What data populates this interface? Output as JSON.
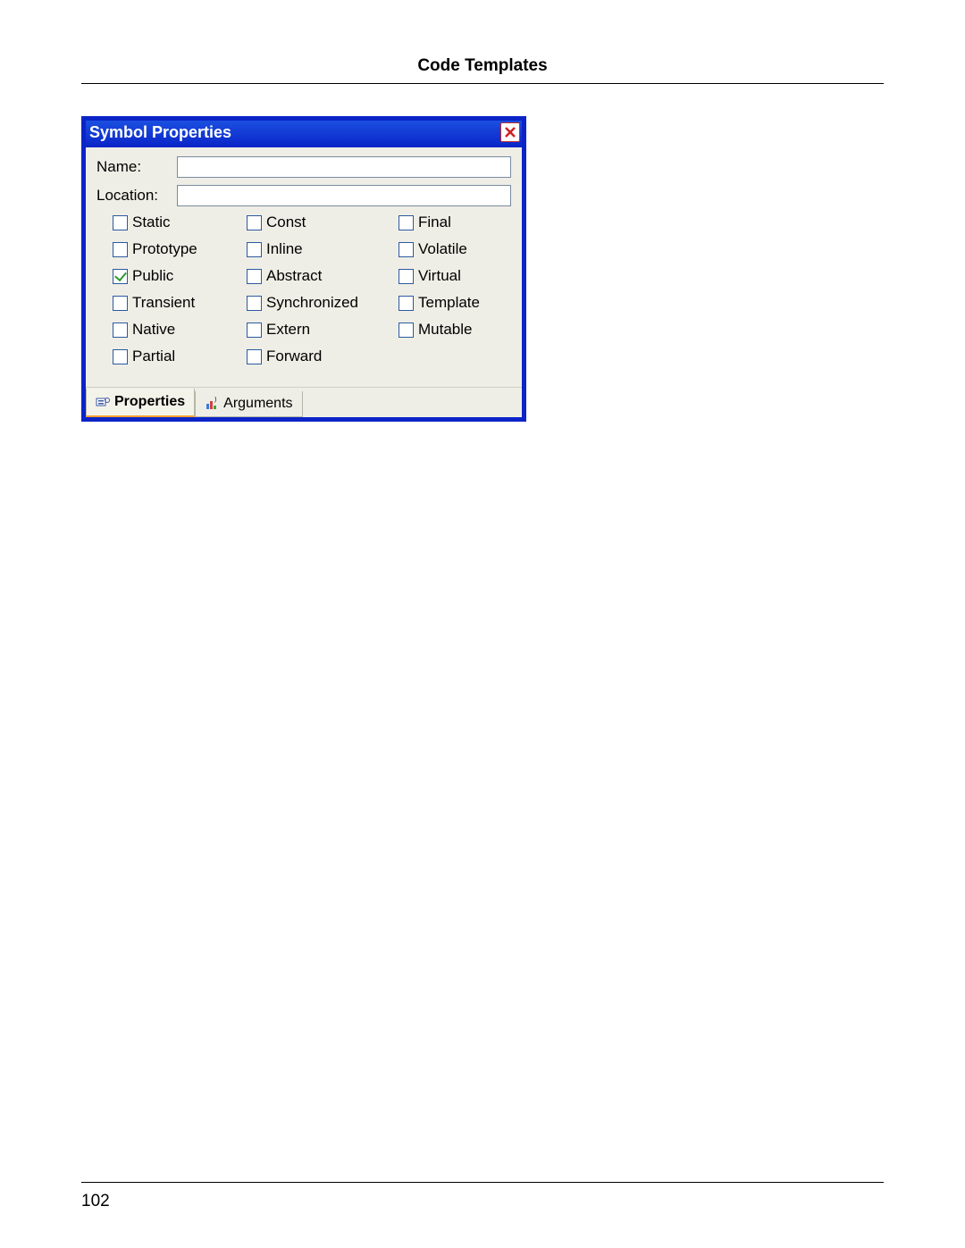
{
  "page": {
    "header": "Code Templates",
    "number": "102"
  },
  "dialog": {
    "title": "Symbol Properties",
    "fields": {
      "name": {
        "label": "Name:",
        "value": ""
      },
      "location": {
        "label": "Location:",
        "value": ""
      }
    },
    "checkboxes": {
      "col1": [
        {
          "label": "Static",
          "checked": false
        },
        {
          "label": "Prototype",
          "checked": false
        },
        {
          "label": "Public",
          "checked": true
        },
        {
          "label": "Transient",
          "checked": false
        },
        {
          "label": "Native",
          "checked": false
        },
        {
          "label": "Partial",
          "checked": false
        }
      ],
      "col2": [
        {
          "label": "Const",
          "checked": false
        },
        {
          "label": "Inline",
          "checked": false
        },
        {
          "label": "Abstract",
          "checked": false
        },
        {
          "label": "Synchronized",
          "checked": false
        },
        {
          "label": "Extern",
          "checked": false
        },
        {
          "label": "Forward",
          "checked": false
        }
      ],
      "col3": [
        {
          "label": "Final",
          "checked": false
        },
        {
          "label": "Volatile",
          "checked": false
        },
        {
          "label": "Virtual",
          "checked": false
        },
        {
          "label": "Template",
          "checked": false
        },
        {
          "label": "Mutable",
          "checked": false
        }
      ]
    },
    "tabs": {
      "properties": "Properties",
      "arguments": "Arguments"
    }
  }
}
